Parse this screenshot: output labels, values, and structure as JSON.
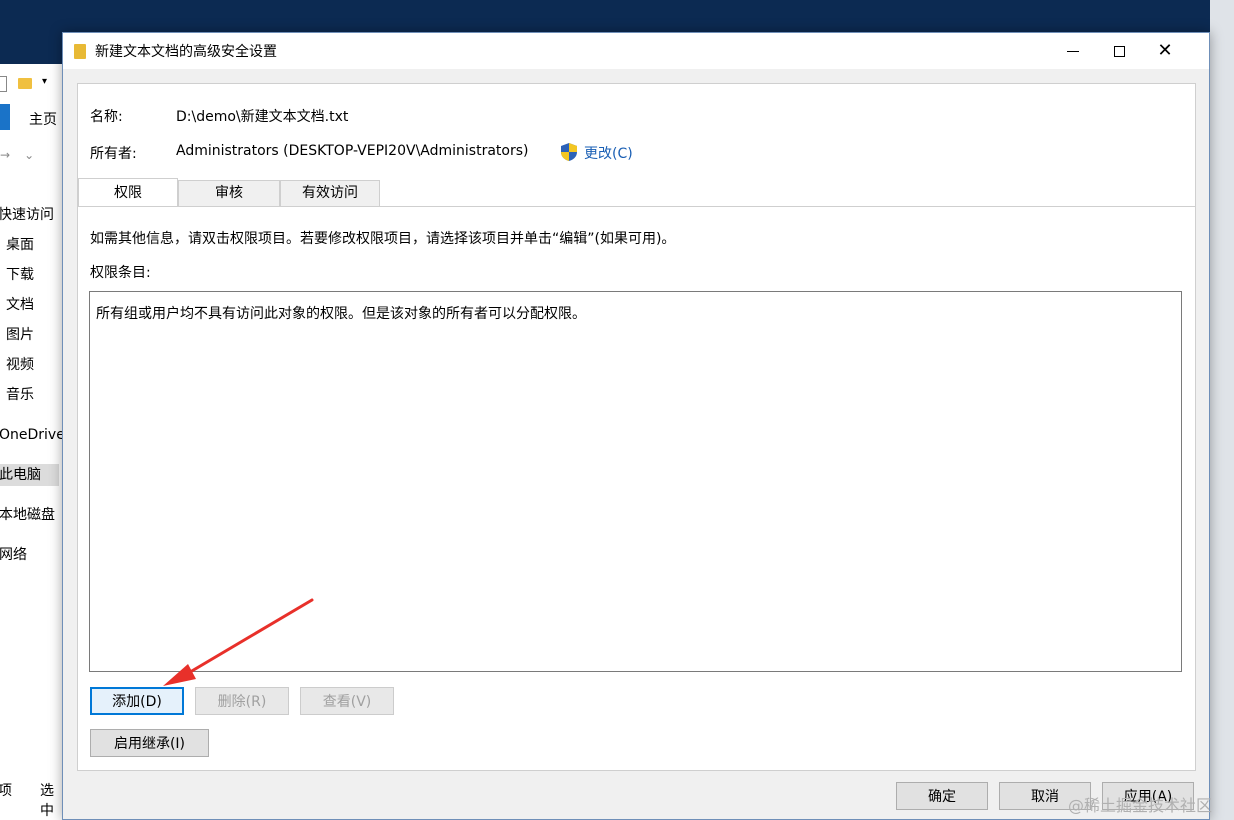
{
  "window": {
    "title": "新建文本文档的高级安全设置",
    "minimize_symbol": "—",
    "close_symbol": "✕"
  },
  "explorer": {
    "ribbon_home": "主页",
    "nav": [
      "快速访问",
      "桌面",
      "下载",
      "文档",
      "图片",
      "视频",
      "音乐",
      "OneDrive",
      "此电脑",
      "本地磁盘",
      "网络"
    ],
    "status_items": [
      "项",
      "选中"
    ]
  },
  "info": {
    "name_label": "名称:",
    "name_value": "D:\\demo\\新建文本文档.txt",
    "owner_label": "所有者:",
    "owner_value": "Administrators (DESKTOP-VEPI20V\\Administrators)",
    "change_link": "更改(C)"
  },
  "tabs": [
    "权限",
    "审核",
    "有效访问"
  ],
  "permissions": {
    "description": "如需其他信息，请双击权限项目。若要修改权限项目，请选择该项目并单击“编辑”(如果可用)。",
    "entries_label": "权限条目:",
    "empty_message": "所有组或用户均不具有访问此对象的权限。但是该对象的所有者可以分配权限。",
    "add_button": "添加(D)",
    "remove_button": "删除(R)",
    "view_button": "查看(V)",
    "inherit_button": "启用继承(I)"
  },
  "footer": {
    "ok_button": "确定",
    "cancel_button": "取消",
    "apply_button": "应用(A)"
  },
  "watermark": "@稀土掘金技术社区",
  "colors": {
    "link": "#1a5fb4",
    "focus_border": "#0078d7",
    "annotation_arrow": "#e8302a"
  }
}
